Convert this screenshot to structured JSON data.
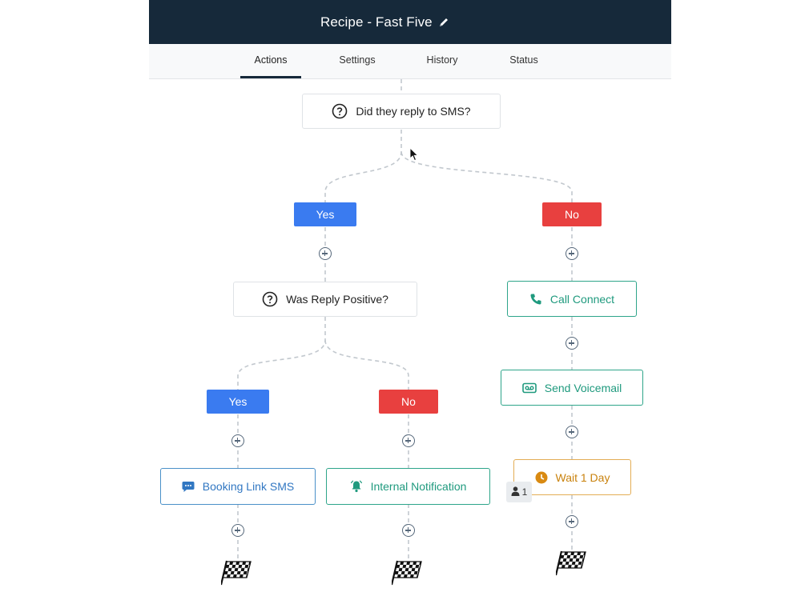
{
  "header": {
    "title": "Recipe - Fast Five",
    "edit_icon": "pencil-icon"
  },
  "tabs": [
    {
      "label": "Actions",
      "active": true
    },
    {
      "label": "Settings",
      "active": false
    },
    {
      "label": "History",
      "active": false
    },
    {
      "label": "Status",
      "active": false
    }
  ],
  "flow": {
    "decision_1": {
      "label": "Did they reply to SMS?",
      "icon": "question-circle-icon"
    },
    "decision_1_yes": "Yes",
    "decision_1_no": "No",
    "decision_2": {
      "label": "Was Reply Positive?",
      "icon": "question-circle-icon"
    },
    "decision_2_yes": "Yes",
    "decision_2_no": "No",
    "booking_link_sms": {
      "label": "Booking Link SMS",
      "icon": "chat-bubble-icon"
    },
    "internal_notification": {
      "label": "Internal Notification",
      "icon": "bell-icon"
    },
    "call_connect": {
      "label": "Call Connect",
      "icon": "phone-icon"
    },
    "send_voicemail": {
      "label": "Send Voicemail",
      "icon": "voicemail-icon"
    },
    "wait": {
      "label": "Wait 1 Day",
      "icon": "clock-icon",
      "contacts_badge": "1"
    },
    "end_icon": "checkered-flag-icon",
    "add_step_icon": "plus-circle-icon"
  },
  "colors": {
    "header_bg": "#16293a",
    "yes": "#3a7bf0",
    "no": "#e8403f",
    "green_action": "#1f9a7e",
    "blue_action": "#3177c2",
    "wait_action": "#c9820d"
  }
}
